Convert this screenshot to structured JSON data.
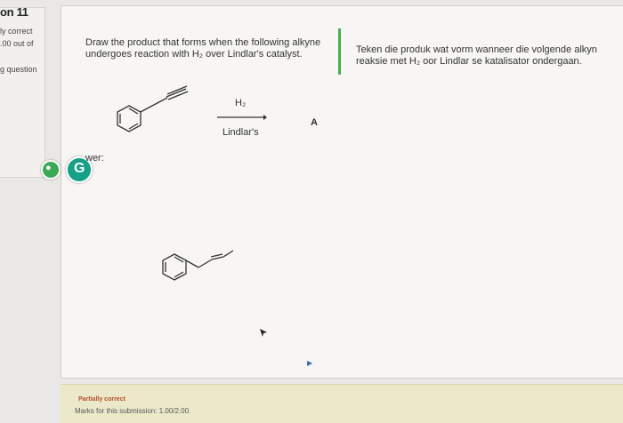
{
  "sidebar": {
    "question_number": "on 11",
    "status": "ly correct",
    "marks": ".00 out of",
    "flag_label": "g question"
  },
  "question": {
    "prompt_english_line1": "Draw the product that forms when the following alkyne",
    "prompt_english_line2": "undergoes reaction with H₂ over Lindlar's catalyst.",
    "prompt_afrikaans_line1": "Teken die produk wat vorm wanneer die volgende alkyn",
    "prompt_afrikaans_line2": "reaksie met H₂ oor Lindlar se katalisator ondergaan.",
    "reagent_above_arrow": "H₂",
    "reagent_below_arrow": "Lindlar's",
    "product_label": "A"
  },
  "answer": {
    "label": "wer:"
  },
  "feedback": {
    "state": "Partially correct",
    "marks_text": "Marks for this submission: 1.00/2.00."
  },
  "colors": {
    "accent_green": "#47b04b",
    "grammar_teal": "#16a085",
    "feedback_bg": "#ebe9c9",
    "partial_red": "#b44c2a"
  }
}
